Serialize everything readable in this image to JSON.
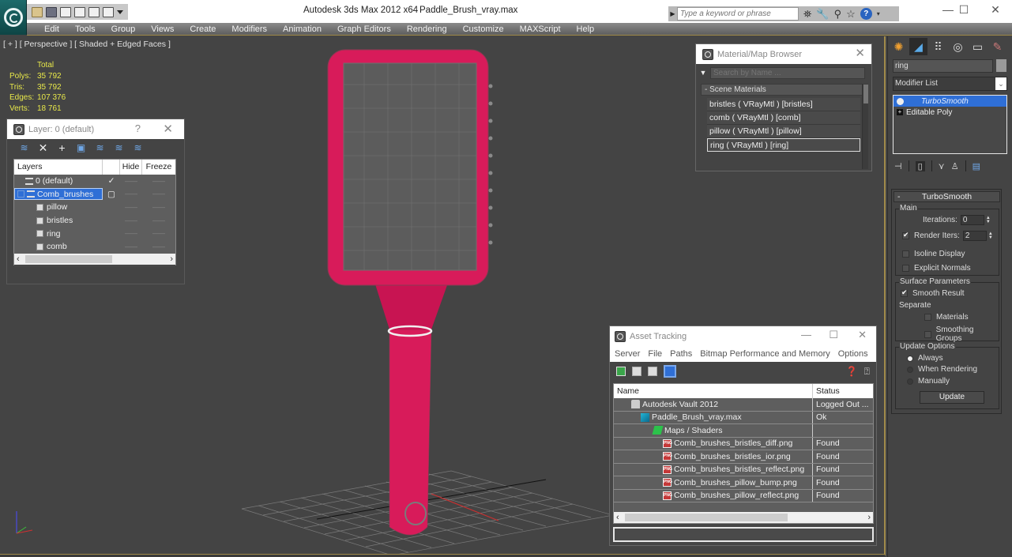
{
  "window": {
    "app_title": "Autodesk 3ds Max  2012 x64",
    "file_title": "Paddle_Brush_vray.max",
    "search_placeholder": "Type a keyword or phrase",
    "minimize": "—",
    "maximize": "☐",
    "close": "✕"
  },
  "quick_access": [
    "open-icon",
    "save-icon",
    "new-icon",
    "project-icon",
    "window-icon",
    "window2-icon"
  ],
  "menu": [
    "Edit",
    "Tools",
    "Group",
    "Views",
    "Create",
    "Modifiers",
    "Animation",
    "Graph Editors",
    "Rendering",
    "Customize",
    "MAXScript",
    "Help"
  ],
  "viewport": {
    "label": "[ + ] [ Perspective ] [ Shaded + Edged Faces ]",
    "stats": {
      "header": "Total",
      "rows": [
        {
          "label": "Polys:",
          "value": "35 792"
        },
        {
          "label": "Tris:",
          "value": "35 792"
        },
        {
          "label": "Edges:",
          "value": "107 376"
        },
        {
          "label": "Verts:",
          "value": "18 761"
        }
      ]
    },
    "object_color": "#d81b5a"
  },
  "layer_panel": {
    "title": "Layer: 0 (default)",
    "help": "?",
    "close": "✕",
    "columns": {
      "layers": "Layers",
      "hide": "Hide",
      "freeze": "Freeze"
    },
    "rows": [
      {
        "name": "0 (default)",
        "type": "layer",
        "check": "✓",
        "hide": "——",
        "freeze": "——"
      },
      {
        "name": "Comb_brushes",
        "type": "layer",
        "check": "▢",
        "hide": "——",
        "freeze": "——",
        "selected": true
      },
      {
        "name": "pillow",
        "type": "object",
        "check": "",
        "hide": "——",
        "freeze": "——"
      },
      {
        "name": "bristles",
        "type": "object",
        "check": "",
        "hide": "——",
        "freeze": "——"
      },
      {
        "name": "ring",
        "type": "object",
        "check": "",
        "hide": "——",
        "freeze": "——"
      },
      {
        "name": "comb",
        "type": "object",
        "check": "",
        "hide": "——",
        "freeze": "——"
      }
    ],
    "scroll_left": "‹",
    "scroll_right": "›"
  },
  "material_browser": {
    "title": "Material/Map Browser",
    "close": "✕",
    "search_placeholder": "Search by Name ...",
    "group": "- Scene Materials",
    "items": [
      "bristles  ( VRayMtl ) [bristles]",
      "comb  ( VRayMtl ) [comb]",
      "pillow  ( VRayMtl ) [pillow]",
      "ring  ( VRayMtl ) [ring]"
    ],
    "selected_index": 3
  },
  "command_panel": {
    "object_name": "ring",
    "modifier_list": "Modifier List",
    "stack": [
      {
        "label": "TurboSmooth",
        "selected": true
      },
      {
        "label": "Editable Poly",
        "selected": false
      }
    ],
    "turbosmooth": {
      "title": "TurboSmooth",
      "main_label": "Main",
      "iterations_label": "Iterations:",
      "iterations": "0",
      "render_iters_label": "Render Iters:",
      "render_iters": "2",
      "render_iters_checked": true,
      "isoline_label": "Isoline Display",
      "isoline_checked": false,
      "explicit_label": "Explicit Normals",
      "explicit_checked": false,
      "surface_label": "Surface Parameters",
      "smooth_result_label": "Smooth Result",
      "smooth_result_checked": true,
      "separate_label": "Separate",
      "materials_label": "Materials",
      "materials_checked": false,
      "smoothing_groups_label": "Smoothing Groups",
      "smoothing_groups_checked": false,
      "update_options_label": "Update Options",
      "radio_always": "Always",
      "radio_rendering": "When Rendering",
      "radio_manually": "Manually",
      "selected_update": "Always",
      "update_button": "Update"
    }
  },
  "asset_tracking": {
    "title": "Asset Tracking",
    "menu": [
      "Server",
      "File",
      "Paths",
      "Bitmap Performance and Memory",
      "Options"
    ],
    "columns": {
      "name": "Name",
      "status": "Status"
    },
    "rows": [
      {
        "name": "Autodesk Vault 2012",
        "status": "Logged Out ...",
        "icon": "vault",
        "indent": 1
      },
      {
        "name": "Paddle_Brush_vray.max",
        "status": "Ok",
        "icon": "max",
        "indent": 2
      },
      {
        "name": "Maps / Shaders",
        "status": "",
        "icon": "folder",
        "indent": 3
      },
      {
        "name": "Comb_brushes_bristles_diff.png",
        "status": "Found",
        "icon": "png",
        "indent": 4
      },
      {
        "name": "Comb_brushes_bristles_ior.png",
        "status": "Found",
        "icon": "png",
        "indent": 4
      },
      {
        "name": "Comb_brushes_bristles_reflect.png",
        "status": "Found",
        "icon": "png",
        "indent": 4
      },
      {
        "name": "Comb_brushes_pillow_bump.png",
        "status": "Found",
        "icon": "png",
        "indent": 4
      },
      {
        "name": "Comb_brushes_pillow_reflect.png",
        "status": "Found",
        "icon": "png",
        "indent": 4
      }
    ],
    "scroll_left": "‹",
    "scroll_right": "›"
  }
}
